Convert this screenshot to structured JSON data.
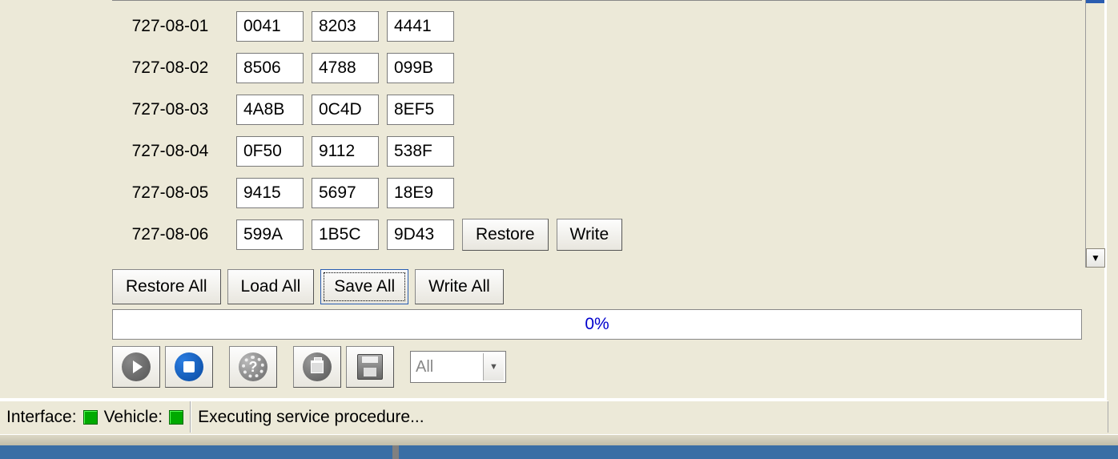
{
  "rows": [
    {
      "label": "727-08-01",
      "c0": "0041",
      "c1": "8203",
      "c2": "4441"
    },
    {
      "label": "727-08-02",
      "c0": "8506",
      "c1": "4788",
      "c2": "099B"
    },
    {
      "label": "727-08-03",
      "c0": "4A8B",
      "c1": "0C4D",
      "c2": "8EF5"
    },
    {
      "label": "727-08-04",
      "c0": "0F50",
      "c1": "9112",
      "c2": "538F"
    },
    {
      "label": "727-08-05",
      "c0": "9415",
      "c1": "5697",
      "c2": "18E9"
    },
    {
      "label": "727-08-06",
      "c0": "599A",
      "c1": "1B5C",
      "c2": "9D43"
    }
  ],
  "row_buttons": {
    "restore": "Restore",
    "write": "Write"
  },
  "controls": {
    "restore_all": "Restore All",
    "load_all": "Load All",
    "save_all": "Save All",
    "write_all": "Write All"
  },
  "progress_text": "0%",
  "filter_combo": {
    "value": "All"
  },
  "status": {
    "interface_label": "Interface:",
    "vehicle_label": "Vehicle:",
    "message": "Executing service procedure...",
    "interface_color": "#00aa00",
    "vehicle_color": "#00aa00"
  }
}
